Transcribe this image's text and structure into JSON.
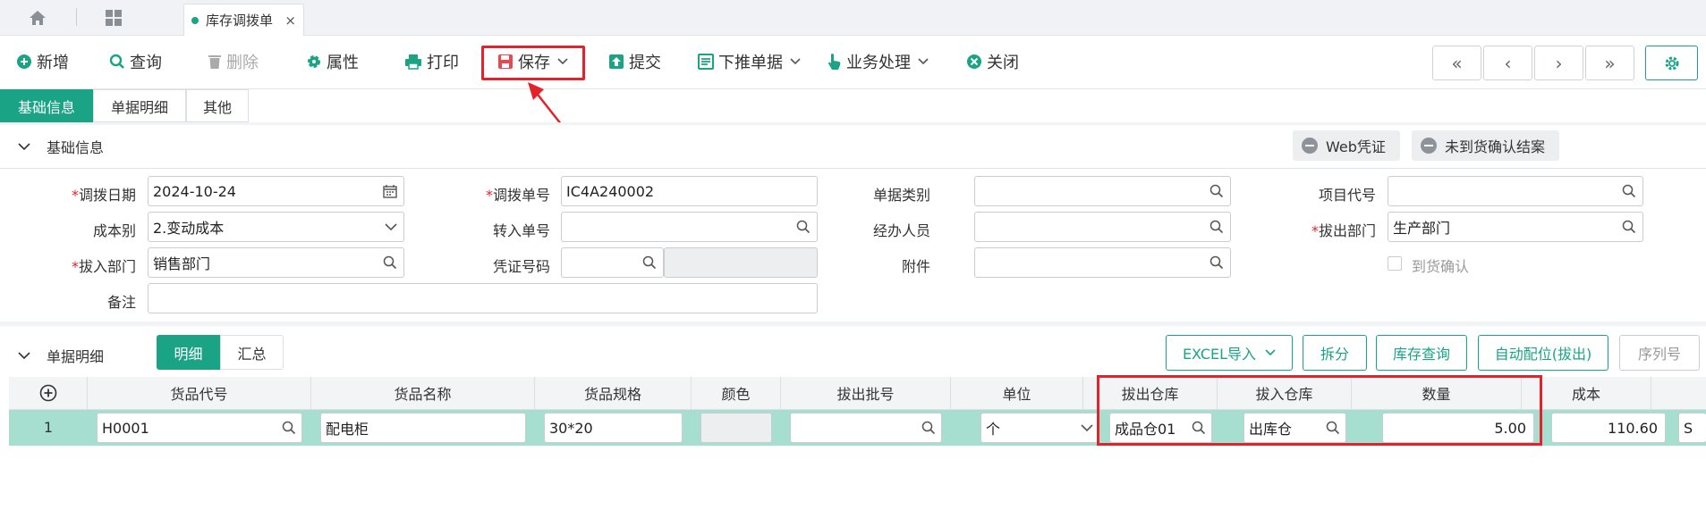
{
  "tabbar": {
    "doc_tab_label": "库存调拨单",
    "close_glyph": "×"
  },
  "toolbar": {
    "add": "新增",
    "query": "查询",
    "delete": "删除",
    "properties": "属性",
    "print": "打印",
    "save": "保存",
    "submit": "提交",
    "push_down": "下推单据",
    "business": "业务处理",
    "close": "关闭"
  },
  "nav": {
    "first": "«",
    "prev": "‹",
    "next": "›",
    "last": "»"
  },
  "section_tabs": [
    "基础信息",
    "单据明细",
    "其他"
  ],
  "basic": {
    "title": "基础信息",
    "web_voucher": "Web凭证",
    "unarrived_confirm": "未到货确认结案",
    "labels": {
      "transfer_date": "调拨日期",
      "transfer_no": "调拨单号",
      "doc_type": "单据类别",
      "project_code": "项目代号",
      "cost_type": "成本别",
      "transfer_in_no": "转入单号",
      "handler": "经办人员",
      "out_dept": "拔出部门",
      "in_dept": "拔入部门",
      "voucher_no": "凭证号码",
      "attachment": "附件",
      "arrival_confirm": "到货确认",
      "remark": "备注"
    },
    "values": {
      "transfer_date": "2024-10-24",
      "transfer_no": "IC4A240002",
      "cost_type": "2.变动成本",
      "out_dept": "生产部门",
      "in_dept": "销售部门"
    },
    "required_mark": "*"
  },
  "detail": {
    "title": "单据明细",
    "view_tabs": [
      "明细",
      "汇总"
    ],
    "buttons": {
      "excel_import": "EXCEL导入",
      "split": "拆分",
      "stock_query": "库存查询",
      "auto_allocate": "自动配位(拔出)",
      "serial": "序列号"
    },
    "columns": [
      "货品代号",
      "货品名称",
      "货品规格",
      "颜色",
      "拔出批号",
      "单位",
      "拔出仓库",
      "拔入仓库",
      "数量",
      "成本"
    ],
    "rows": [
      {
        "no": "1",
        "code": "H0001",
        "name": "配电柜",
        "spec": "30*20",
        "color": "",
        "batch": "",
        "unit": "个",
        "out_wh": "成品仓01",
        "in_wh": "出库仓",
        "qty": "5.00",
        "cost": "110.60",
        "extra": "S"
      }
    ]
  },
  "colors": {
    "accent": "#1aa385",
    "highlight": "#e3222b",
    "row_selected": "#a6dfd0"
  }
}
